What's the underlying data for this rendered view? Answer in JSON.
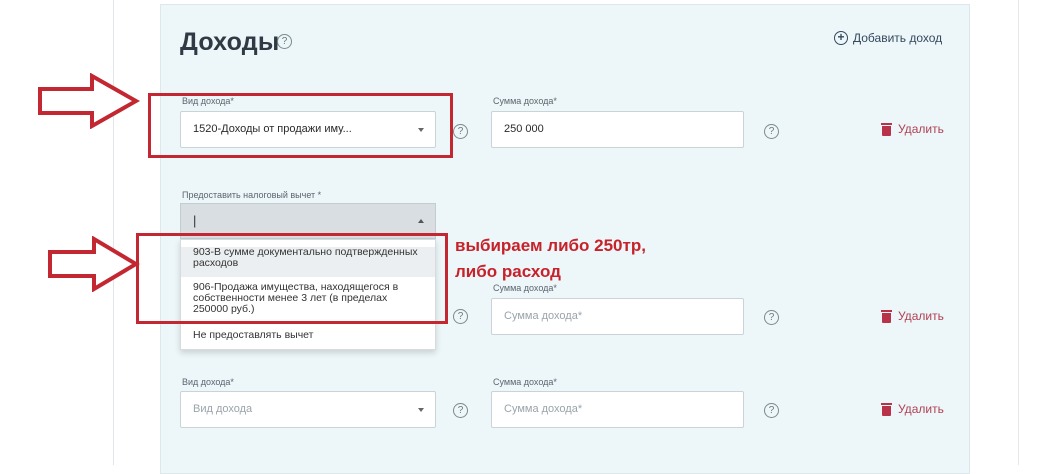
{
  "section": {
    "title": "Доходы",
    "add_link": "Добавить доход"
  },
  "income_rows": [
    {
      "type_label": "Вид дохода*",
      "type_value": "1520-Доходы от продажи иму...",
      "amount_label": "Сумма дохода*",
      "amount_value": "250 000",
      "delete_label": "Удалить"
    },
    {
      "amount_label": "Сумма дохода*",
      "amount_placeholder": "Сумма дохода*",
      "delete_label": "Удалить"
    },
    {
      "type_label": "Вид дохода*",
      "type_placeholder": "Вид дохода",
      "amount_label": "Сумма дохода*",
      "amount_placeholder": "Сумма дохода*",
      "delete_label": "Удалить"
    }
  ],
  "deduction": {
    "label": "Предоставить налоговый вычет *",
    "current_value": "|",
    "options": [
      "903-В сумме документально подтвержденных расходов",
      "906-Продажа имущества, находящегося в собственности менее 3 лет (в пределах 250000 руб.)",
      "Не предоставлять вычет"
    ]
  },
  "annotation": {
    "line1": "выбираем либо 250тр,",
    "line2": "либо расход"
  },
  "colors": {
    "panel_bg": "#edf6f8",
    "annotation_red": "#c7222a",
    "delete_red": "#b04154"
  },
  "icons": [
    "help-icon",
    "plus-circle-icon",
    "trash-icon",
    "chevron-down-icon",
    "arrow-right-icon"
  ]
}
